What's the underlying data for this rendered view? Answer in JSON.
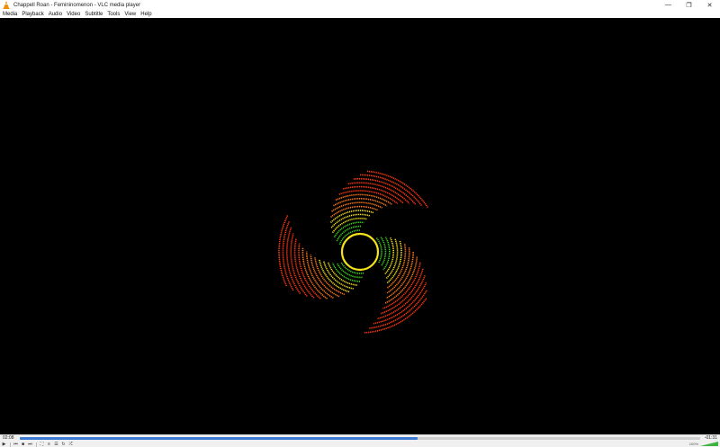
{
  "window": {
    "title": "Chappell Roan - Femininomenon - VLC media player",
    "controls": {
      "minimize": "—",
      "restore": "❐",
      "close": "✕"
    }
  },
  "menu": [
    "Media",
    "Playback",
    "Audio",
    "Video",
    "Subtitle",
    "Tools",
    "View",
    "Help"
  ],
  "player": {
    "elapsed": "02:08",
    "remaining": "-01:31",
    "progress": 0.585,
    "volume_label": "100%",
    "volume": 1.0
  },
  "colors": {
    "accent": "#3b7bd6",
    "vlc_orange": "#f28c00",
    "viz_red": "#ff3a10",
    "viz_orange": "#ff7a1a",
    "viz_yellow": "#f4e21a",
    "viz_green": "#3fd11c"
  },
  "icons": [
    "vlc-cone-icon",
    "play-icon",
    "previous-icon",
    "stop-icon",
    "next-icon",
    "fullscreen-icon",
    "playlist-icon",
    "extended-settings-icon",
    "loop-icon",
    "shuffle-icon"
  ]
}
